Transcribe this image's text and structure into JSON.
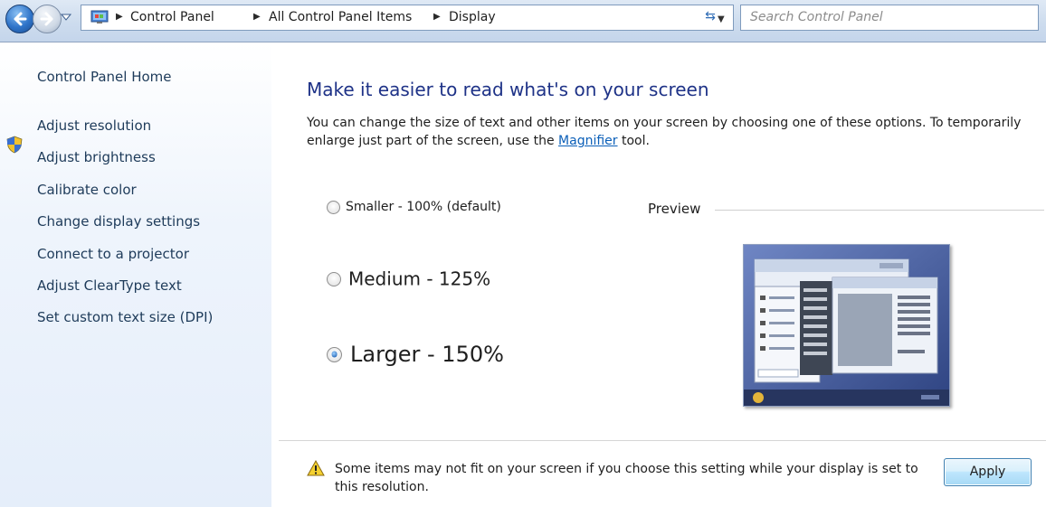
{
  "address_bar": {
    "crumbs": [
      "Control Panel",
      "All Control Panel Items",
      "Display"
    ],
    "search_placeholder": "Search Control Panel"
  },
  "left_pane": {
    "home_link": "Control Panel Home",
    "links": [
      "Adjust resolution",
      "Adjust brightness",
      "Calibrate color",
      "Change display settings",
      "Connect to a projector",
      "Adjust ClearType text",
      "Set custom text size (DPI)"
    ]
  },
  "main": {
    "title": "Make it easier to read what's on your screen",
    "description_before": "You can change the size of text and other items on your screen by choosing one of these options. To temporarily enlarge just part of the screen, use the ",
    "magnifier_link": "Magnifier",
    "description_after": " tool.",
    "options": [
      {
        "label": "Smaller - 100% (default)",
        "selected": false
      },
      {
        "label": "Medium - 125%",
        "selected": false
      },
      {
        "label": "Larger - 150%",
        "selected": true
      }
    ],
    "preview_label": "Preview",
    "warning": "Some items may not fit on your screen if you choose this setting while your display is set to this resolution.",
    "apply_label": "Apply"
  },
  "colors": {
    "title_blue": "#1e3287",
    "link_blue": "#0b5fb8",
    "left_link": "#1e3b5a",
    "preview_background": "#3a4f8a"
  }
}
